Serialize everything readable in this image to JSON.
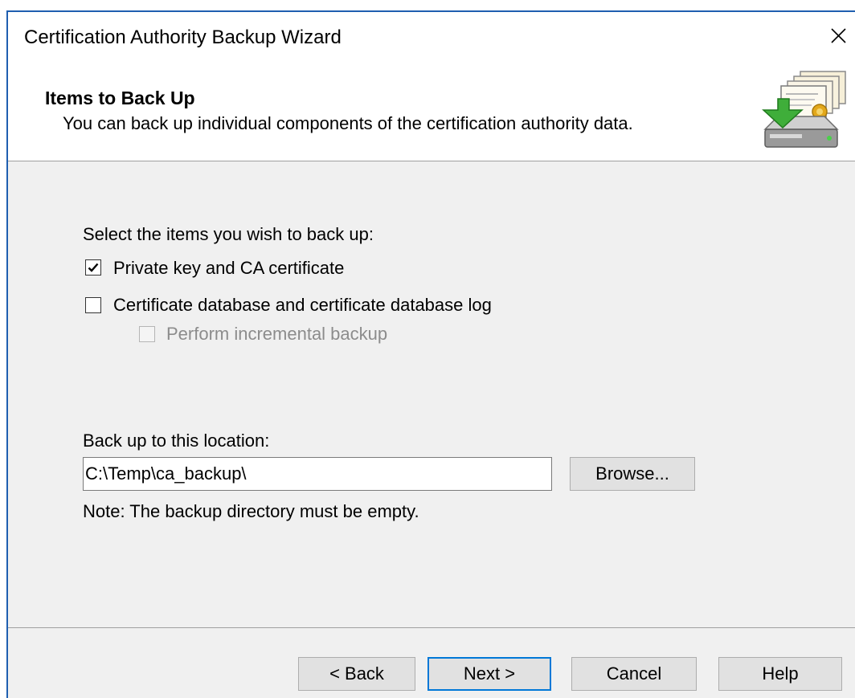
{
  "window": {
    "title": "Certification Authority Backup Wizard",
    "close_glyph": "✕"
  },
  "header": {
    "title": "Items to Back Up",
    "subtitle": "You can back up individual components of the certification authority data.",
    "icon": "certificate-backup-icon"
  },
  "content": {
    "select_prompt": "Select the items you wish to back up:",
    "options": [
      {
        "label": "Private key and CA certificate",
        "checked": true,
        "enabled": true
      },
      {
        "label": "Certificate database and certificate database log",
        "checked": false,
        "enabled": true
      },
      {
        "label": "Perform incremental backup",
        "checked": false,
        "enabled": false
      }
    ],
    "location_label": "Back up to this location:",
    "location_value": "C:\\Temp\\ca_backup\\",
    "browse_label": "Browse...",
    "note": "Note: The backup directory must be empty."
  },
  "footer": {
    "back_label": "< Back",
    "next_label": "Next >",
    "cancel_label": "Cancel",
    "help_label": "Help"
  },
  "colors": {
    "window_border": "#1f5fb0",
    "default_button_border": "#0078d7",
    "panel_background": "#f0f0f0"
  }
}
